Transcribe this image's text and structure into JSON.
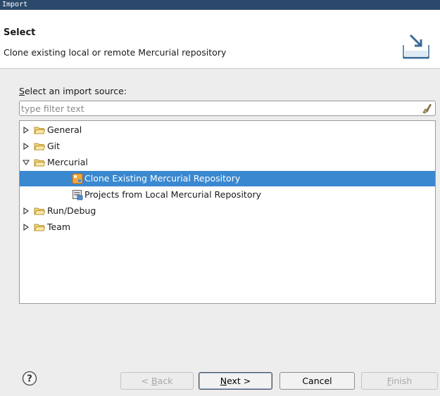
{
  "window": {
    "title": "Import"
  },
  "banner": {
    "heading": "Select",
    "description": "Clone existing local or remote Mercurial repository",
    "icon": "import-wizard-icon"
  },
  "source": {
    "label": "Select an import source:",
    "filter_placeholder": "type filter text",
    "filter_value": ""
  },
  "tree": [
    {
      "label": "General",
      "icon": "folder-icon",
      "expanded": false,
      "depth": 0
    },
    {
      "label": "Git",
      "icon": "folder-icon",
      "expanded": false,
      "depth": 0
    },
    {
      "label": "Mercurial",
      "icon": "folder-icon",
      "expanded": true,
      "depth": 0
    },
    {
      "label": "Clone Existing Mercurial Repository",
      "icon": "mercurial-clone-icon",
      "depth": 1,
      "selected": true
    },
    {
      "label": "Projects from Local Mercurial Repository",
      "icon": "mercurial-project-icon",
      "depth": 1
    },
    {
      "label": "Run/Debug",
      "icon": "folder-icon",
      "expanded": false,
      "depth": 0
    },
    {
      "label": "Team",
      "icon": "folder-icon",
      "expanded": false,
      "depth": 0
    }
  ],
  "buttons": {
    "back": "< Back",
    "next": "Next >",
    "cancel": "Cancel",
    "finish": "Finish"
  },
  "colors": {
    "selection": "#3a88d0",
    "titlebar": "#2b4a6b"
  }
}
